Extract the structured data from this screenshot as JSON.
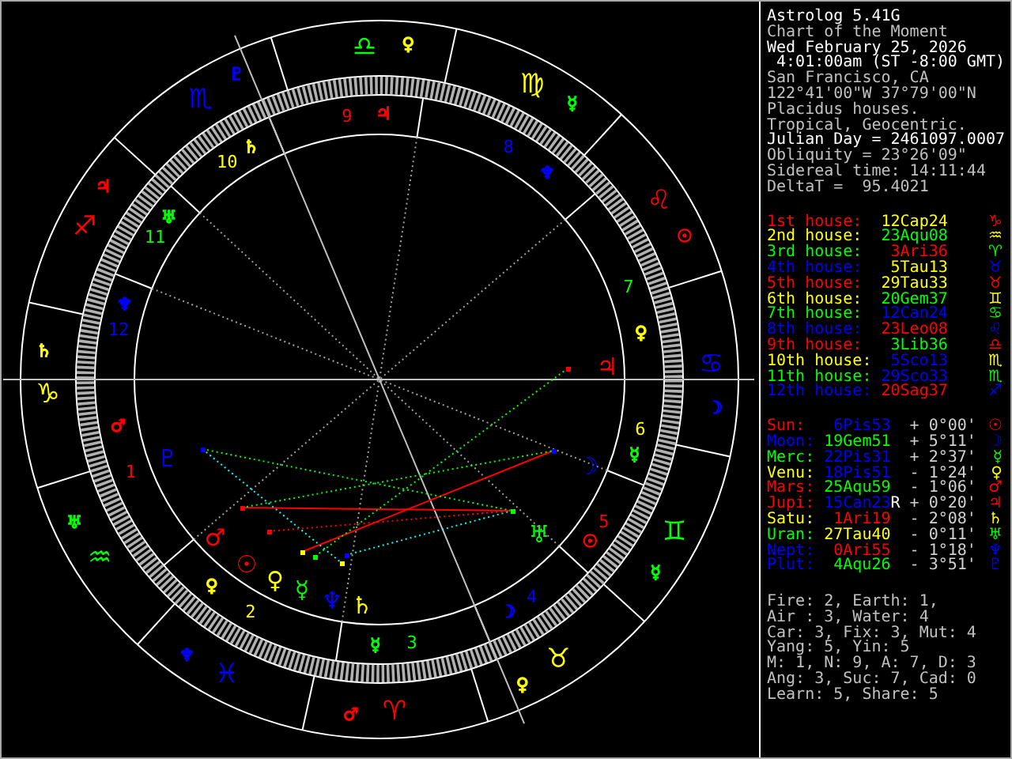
{
  "header": [
    {
      "text": "Astrolog 5.41G",
      "color": "#ffffff"
    },
    {
      "text": "Chart of the Moment",
      "color": "#c0c0c0"
    },
    {
      "text": "Wed February 25, 2026",
      "color": "#ffffff"
    },
    {
      "text": " 4:01:00am (ST -8:00 GMT)",
      "color": "#ffffff"
    },
    {
      "text": "San Francisco, CA",
      "color": "#c0c0c0"
    },
    {
      "text": "122°41'00\"W 37°79'00\"N",
      "color": "#c0c0c0"
    },
    {
      "text": "Placidus houses.",
      "color": "#c0c0c0"
    },
    {
      "text": "Tropical, Geocentric.",
      "color": "#c0c0c0"
    },
    {
      "text": "Julian Day = 2461097.0007",
      "color": "#ffffff"
    },
    {
      "text": "Obliquity = 23°26'09\"",
      "color": "#c0c0c0"
    },
    {
      "text": "Sidereal time: 14:11:44",
      "color": "#c0c0c0"
    },
    {
      "text": "DeltaT =  95.4021",
      "color": "#c0c0c0"
    }
  ],
  "houses": [
    {
      "label": "1st house:",
      "color": "#ff0000",
      "position": {
        "text": "12Cap24",
        "color": "#ffff00"
      },
      "glyph": "♑"
    },
    {
      "label": "2nd house:",
      "color": "#ffff00",
      "position": {
        "text": "23Aqu08",
        "color": "#00ff00"
      },
      "glyph": "♒"
    },
    {
      "label": "3rd house:",
      "color": "#00ff00",
      "position": {
        "text": "3Ari36",
        "color": "#ff0000"
      },
      "glyph": "♈"
    },
    {
      "label": "4th house:",
      "color": "#0000ff",
      "position": {
        "text": "5Tau13",
        "color": "#ffff00"
      },
      "glyph": "♉"
    },
    {
      "label": "5th house:",
      "color": "#ff0000",
      "position": {
        "text": "29Tau33",
        "color": "#ffff00"
      },
      "glyph": "♉"
    },
    {
      "label": "6th house:",
      "color": "#ffff00",
      "position": {
        "text": "20Gem37",
        "color": "#00ff00"
      },
      "glyph": "♊"
    },
    {
      "label": "7th house:",
      "color": "#00ff00",
      "position": {
        "text": "12Can24",
        "color": "#0000ff"
      },
      "glyph": "♋"
    },
    {
      "label": "8th house:",
      "color": "#0000ff",
      "position": {
        "text": "23Leo08",
        "color": "#ff0000"
      },
      "glyph": "♌"
    },
    {
      "label": "9th house:",
      "color": "#ff0000",
      "position": {
        "text": "3Lib36",
        "color": "#00ff00"
      },
      "glyph": "♎"
    },
    {
      "label": "10th house:",
      "color": "#ffff00",
      "position": {
        "text": "5Sco13",
        "color": "#0000ff"
      },
      "glyph": "♏"
    },
    {
      "label": "11th house:",
      "color": "#00ff00",
      "position": {
        "text": "29Sco33",
        "color": "#0000ff"
      },
      "glyph": "♏"
    },
    {
      "label": "12th house:",
      "color": "#0000ff",
      "position": {
        "text": "20Sag37",
        "color": "#ff0000"
      },
      "glyph": "♐"
    }
  ],
  "planets": [
    {
      "name": "Sun:",
      "color": "#ff0000",
      "position": {
        "text": "6Pis53",
        "color": "#0000ff"
      },
      "latitude": "+ 0°00'",
      "glyph": "☉"
    },
    {
      "name": "Moon:",
      "color": "#0000ff",
      "position": {
        "text": "19Gem51",
        "color": "#00ff00"
      },
      "latitude": "+ 5°11'",
      "glyph": "☽"
    },
    {
      "name": "Merc:",
      "color": "#00ff00",
      "position": {
        "text": "22Pis31",
        "color": "#0000ff"
      },
      "latitude": "+ 2°37'",
      "glyph": "☿"
    },
    {
      "name": "Venu:",
      "color": "#ffff00",
      "position": {
        "text": "18Pis51",
        "color": "#0000ff"
      },
      "latitude": "- 1°24'",
      "glyph": "♀"
    },
    {
      "name": "Mars:",
      "color": "#ff0000",
      "position": {
        "text": "25Aqu59",
        "color": "#00ff00"
      },
      "latitude": "- 1°06'",
      "glyph": "♂"
    },
    {
      "name": "Jupi:",
      "color": "#ff0000",
      "position": {
        "text": "15Can23",
        "color": "#0000ff"
      },
      "flag": "R",
      "latitude": "+ 0°20'",
      "glyph": "♃"
    },
    {
      "name": "Satu:",
      "color": "#ffff00",
      "position": {
        "text": "1Ari19",
        "color": "#ff0000"
      },
      "latitude": "- 2°08'",
      "glyph": "♄"
    },
    {
      "name": "Uran:",
      "color": "#00ff00",
      "position": {
        "text": "27Tau40",
        "color": "#ffff00"
      },
      "latitude": "- 0°11'",
      "glyph": "♅"
    },
    {
      "name": "Nept:",
      "color": "#0000ff",
      "position": {
        "text": "0Ari55",
        "color": "#ff0000"
      },
      "latitude": "- 1°18'",
      "glyph": "♆"
    },
    {
      "name": "Plut:",
      "color": "#0000ff",
      "position": {
        "text": "4Aqu26",
        "color": "#00ff00"
      },
      "latitude": "- 3°51'",
      "glyph": "♇"
    }
  ],
  "summary": [
    "Fire: 2, Earth: 1,",
    "Air : 3, Water: 4",
    "Car: 3, Fix: 3, Mut: 4",
    "Yang: 5, Yin: 5",
    "M: 1, N: 9, A: 7, D: 3",
    "Ang: 3, Suc: 7, Cad: 0",
    "Learn: 5, Share: 5"
  ],
  "wheel": {
    "signs": [
      {
        "glyph": "♈",
        "color": "#ff0000",
        "ruler": {
          "glyph": "♂",
          "color": "#ff0000"
        }
      },
      {
        "glyph": "♉",
        "color": "#ffff00",
        "ruler": {
          "glyph": "♀",
          "color": "#ffff00"
        }
      },
      {
        "glyph": "♊",
        "color": "#00ff00",
        "ruler": {
          "glyph": "☿",
          "color": "#00ff00"
        }
      },
      {
        "glyph": "♋",
        "color": "#0000ff",
        "ruler": {
          "glyph": "☽",
          "color": "#0000ff"
        }
      },
      {
        "glyph": "♌",
        "color": "#ff0000",
        "ruler": {
          "glyph": "☉",
          "color": "#ff0000"
        }
      },
      {
        "glyph": "♍",
        "color": "#ffff00",
        "ruler": {
          "glyph": "☿",
          "color": "#00ff00"
        }
      },
      {
        "glyph": "♎",
        "color": "#00ff00",
        "ruler": {
          "glyph": "♀",
          "color": "#ffff00"
        }
      },
      {
        "glyph": "♏",
        "color": "#0000ff",
        "ruler": {
          "glyph": "♇",
          "color": "#0000ff"
        }
      },
      {
        "glyph": "♐",
        "color": "#ff0000",
        "ruler": {
          "glyph": "♃",
          "color": "#ff0000"
        }
      },
      {
        "glyph": "♑",
        "color": "#ffff00",
        "ruler": {
          "glyph": "♄",
          "color": "#ffff00"
        }
      },
      {
        "glyph": "♒",
        "color": "#00ff00",
        "ruler": {
          "glyph": "♅",
          "color": "#00ff00"
        }
      },
      {
        "glyph": "♓",
        "color": "#0000ff",
        "ruler": {
          "glyph": "♆",
          "color": "#0000ff"
        }
      }
    ],
    "houses": [
      {
        "number": "1",
        "color": "#ff0000",
        "ruler": {
          "glyph": "♂",
          "color": "#ff0000"
        }
      },
      {
        "number": "2",
        "color": "#ffff00",
        "ruler": {
          "glyph": "♀",
          "color": "#ffff00"
        }
      },
      {
        "number": "3",
        "color": "#00ff00",
        "ruler": {
          "glyph": "☿",
          "color": "#00ff00"
        }
      },
      {
        "number": "4",
        "color": "#0000ff",
        "ruler": {
          "glyph": "☽",
          "color": "#0000ff"
        }
      },
      {
        "number": "5",
        "color": "#ff0000",
        "ruler": {
          "glyph": "☉",
          "color": "#ff0000"
        }
      },
      {
        "number": "6",
        "color": "#ffff00",
        "ruler": {
          "glyph": "☿",
          "color": "#00ff00"
        }
      },
      {
        "number": "7",
        "color": "#00ff00",
        "ruler": {
          "glyph": "♀",
          "color": "#ffff00"
        }
      },
      {
        "number": "8",
        "color": "#0000ff",
        "ruler": {
          "glyph": "♆",
          "color": "#0000ff"
        }
      },
      {
        "number": "9",
        "color": "#ff0000",
        "ruler": {
          "glyph": "♃",
          "color": "#ff0000"
        }
      },
      {
        "number": "10",
        "color": "#ffff00",
        "ruler": {
          "glyph": "♄",
          "color": "#ffff00"
        }
      },
      {
        "number": "11",
        "color": "#00ff00",
        "ruler": {
          "glyph": "♅",
          "color": "#00ff00"
        }
      },
      {
        "number": "12",
        "color": "#0000ff",
        "ruler": {
          "glyph": "♆",
          "color": "#0000ff"
        }
      }
    ],
    "planets": [
      {
        "glyph": "☉",
        "color": "#ff0000"
      },
      {
        "glyph": "☽",
        "color": "#0000ff"
      },
      {
        "glyph": "☿",
        "color": "#00ff00"
      },
      {
        "glyph": "♀",
        "color": "#ffff00"
      },
      {
        "glyph": "♂",
        "color": "#ff0000"
      },
      {
        "glyph": "♃",
        "color": "#ff0000"
      },
      {
        "glyph": "♄",
        "color": "#ffff00"
      },
      {
        "glyph": "♅",
        "color": "#00ff00"
      },
      {
        "glyph": "♆",
        "color": "#0000ff"
      },
      {
        "glyph": "♇",
        "color": "#0000ff"
      }
    ]
  }
}
